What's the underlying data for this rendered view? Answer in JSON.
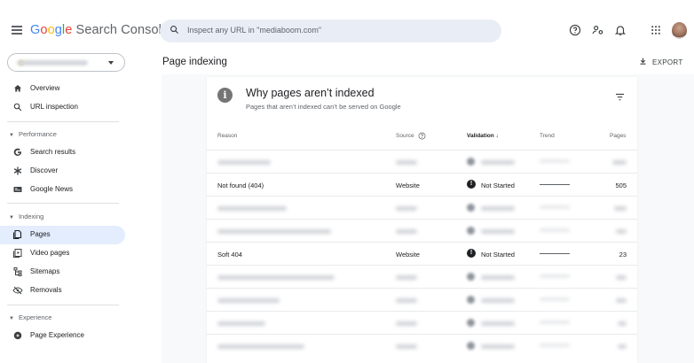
{
  "app": {
    "logo_google": [
      "G",
      "o",
      "o",
      "g",
      "l",
      "e"
    ],
    "logo_rest": "Search Console",
    "search_placeholder": "Inspect any URL in \"mediaboom.com\""
  },
  "topbar_icons": [
    "help-icon",
    "account-settings-icon",
    "notifications-icon",
    "apps-grid-icon"
  ],
  "sidebar": {
    "top_items": [
      {
        "label": "Overview",
        "icon": "home-icon"
      },
      {
        "label": "URL inspection",
        "icon": "search-icon"
      }
    ],
    "sections": [
      {
        "label": "Performance",
        "items": [
          {
            "label": "Search results",
            "icon": "google-g-icon"
          },
          {
            "label": "Discover",
            "icon": "asterisk-icon"
          },
          {
            "label": "Google News",
            "icon": "news-icon"
          }
        ]
      },
      {
        "label": "Indexing",
        "items": [
          {
            "label": "Pages",
            "icon": "pages-icon",
            "active": true
          },
          {
            "label": "Video pages",
            "icon": "video-pages-icon"
          },
          {
            "label": "Sitemaps",
            "icon": "sitemap-icon"
          },
          {
            "label": "Removals",
            "icon": "removals-icon"
          }
        ]
      },
      {
        "label": "Experience",
        "items": [
          {
            "label": "Page Experience",
            "icon": "page-experience-icon"
          }
        ]
      }
    ]
  },
  "main": {
    "title": "Page indexing",
    "export_label": "EXPORT"
  },
  "card": {
    "title": "Why pages aren’t indexed",
    "subtitle": "Pages that aren’t indexed can’t be served on Google",
    "columns": {
      "reason": "Reason",
      "source": "Source",
      "validation": "Validation",
      "trend": "Trend",
      "pages": "Pages"
    },
    "rows": [
      {
        "blurred": true
      },
      {
        "reason": "Not found (404)",
        "source": "Website",
        "validation": "Not Started",
        "pages": "505"
      },
      {
        "blurred": true
      },
      {
        "blurred": true
      },
      {
        "reason": "Soft 404",
        "source": "Website",
        "validation": "Not Started",
        "pages": "23"
      },
      {
        "blurred": true
      },
      {
        "blurred": true
      },
      {
        "blurred": true
      },
      {
        "blurred": true
      }
    ]
  },
  "colors": {
    "accent_blue": "#4285f4",
    "active_nav": "#e3edfd",
    "search_bg": "#e9eef6"
  }
}
